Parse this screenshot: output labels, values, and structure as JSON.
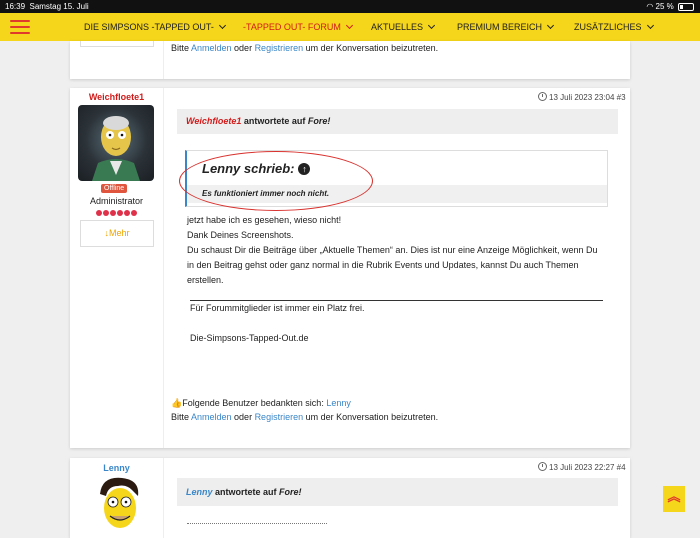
{
  "status": {
    "time": "16:39",
    "date": "Samstag 15. Juli",
    "battery": "25 %"
  },
  "nav": {
    "items": [
      {
        "label": "DIE SIMPSONS -TAPPED OUT-"
      },
      {
        "label": "-TAPPED OUT- FORUM"
      },
      {
        "label": "AKTUELLES"
      },
      {
        "label": "PREMIUM BEREICH"
      },
      {
        "label": "ZUSÄTZLICHES"
      }
    ]
  },
  "prev_post": {
    "login_prefix": "Bitte ",
    "login_link": "Anmelden",
    "login_mid": " oder ",
    "register_link": "Registrieren",
    "login_suffix": " um der Konversation beizutreten."
  },
  "post3": {
    "username": "Weichfloete1",
    "status_badge": "Offline",
    "rank": "Administrator",
    "more_label": "Mehr",
    "more_arrow": "↓",
    "date": "13 Juli 2023 23:04",
    "number": "#3",
    "reply_user": "Weichfloete1",
    "reply_verb": " antwortete auf ",
    "reply_topic": "Fore!",
    "quote_title": "Lenny schrieb:",
    "quote_icon": "↑",
    "quote_text": "Es funktioniert immer noch nicht.",
    "body": [
      "jetzt habe ich es gesehen, wieso nicht!",
      "Dank Deines Screenshots.",
      "Du schaust Dir die Beiträge über „Aktuelle Themen“ an. Dies ist nur eine Anzeige Möglichkeit, wenn Du",
      "in den Beitrag gehst oder ganz normal in die Rubrik Events und Updates, kannst Du auch Themen",
      "erstellen."
    ],
    "signature_1": "Für Forummitglieder ist immer ein Platz frei.",
    "signature_2": "Die-Simpsons-Tapped-Out.de",
    "thanks_label": "Folgende Benutzer bedankten sich: ",
    "thanks_user": "Lenny",
    "login_prefix": "Bitte ",
    "login_link": "Anmelden",
    "login_mid": " oder ",
    "register_link": "Registrieren",
    "login_suffix": " um der Konversation beizutreten."
  },
  "post4": {
    "username": "Lenny",
    "date": "13 Juli 2023 22:27",
    "number": "#4",
    "reply_user": "Lenny",
    "reply_verb": " antwortete auf ",
    "reply_topic": "Fore!"
  },
  "scroll_top_icon": "double-chevron-up",
  "colors": {
    "accent_yellow": "#f5d61a",
    "brand_red": "#d21b1b",
    "link_blue": "#3a86c8",
    "rating_dot": "#e0314a"
  }
}
